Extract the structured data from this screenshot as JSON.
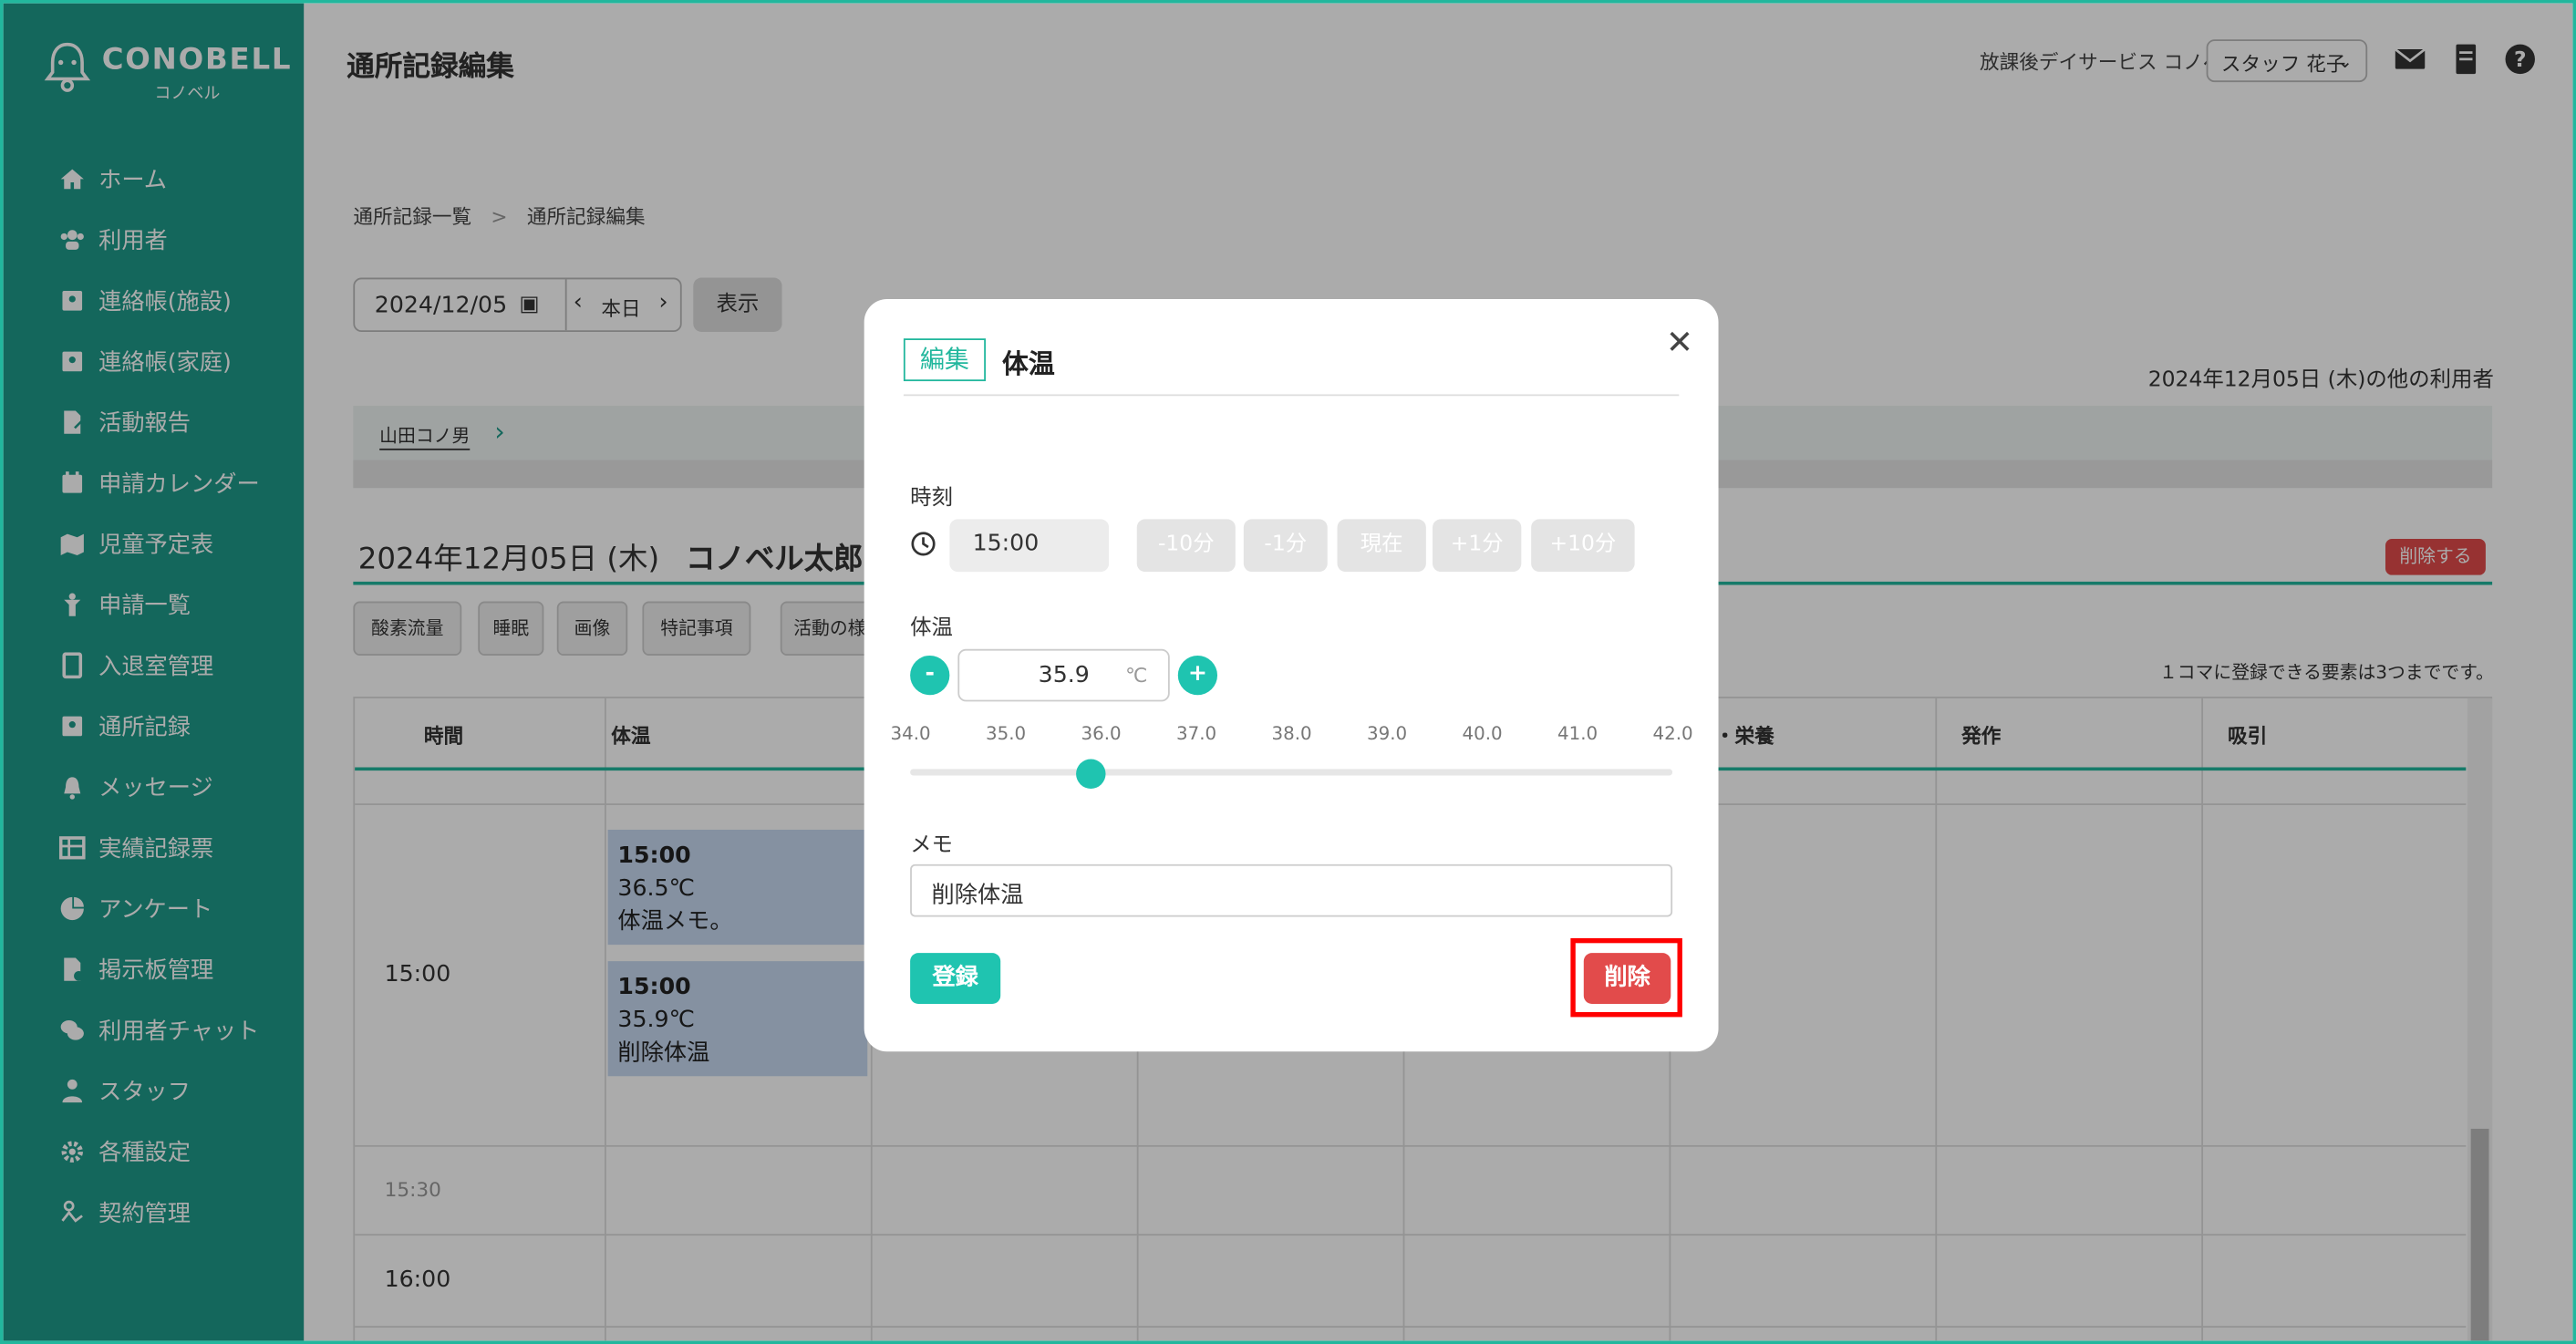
{
  "app": {
    "brand": "CONOBELL",
    "brand_sub": "コノベル"
  },
  "sidebar": {
    "items": [
      {
        "label": "ホーム"
      },
      {
        "label": "利用者"
      },
      {
        "label": "連絡帳(施設)"
      },
      {
        "label": "連絡帳(家庭)"
      },
      {
        "label": "活動報告"
      },
      {
        "label": "申請カレンダー"
      },
      {
        "label": "児童予定表"
      },
      {
        "label": "申請一覧"
      },
      {
        "label": "入退室管理"
      },
      {
        "label": "通所記録"
      },
      {
        "label": "メッセージ"
      },
      {
        "label": "実績記録票"
      },
      {
        "label": "アンケート"
      },
      {
        "label": "掲示板管理"
      },
      {
        "label": "利用者チャット"
      },
      {
        "label": "スタッフ"
      },
      {
        "label": "各種設定"
      },
      {
        "label": "契約管理"
      }
    ]
  },
  "header": {
    "title": "通所記録編集",
    "facility": "放課後デイサービス コノベル",
    "staff": "スタッフ 花子"
  },
  "breadcrumb": {
    "item1": "通所記録一覧",
    "sep": ">",
    "item2": "通所記録編集"
  },
  "date_nav": {
    "date": "2024/12/05",
    "today": "本日",
    "show": "表示"
  },
  "others_label": "2024年12月05日 (木)の他の利用者",
  "user_strip": {
    "name": "山田コノ男"
  },
  "record": {
    "date": "2024年12月05日 (木)",
    "name": "コノベル太郎",
    "delete_label": "削除する"
  },
  "tags": [
    "酸素流量",
    "睡眠",
    "画像",
    "特記事項",
    "活動の様"
  ],
  "limit_note": "１コマに登録できる要素は3つまでです。",
  "grid": {
    "headers": {
      "time": "時間",
      "temp": "体温",
      "nutrition": "・栄養",
      "seizure": "発作",
      "suction": "吸引"
    },
    "times": {
      "t1500": "15:00",
      "t1530": "15:30",
      "t1600": "16:00"
    },
    "entries": [
      {
        "time": "15:00",
        "value": "36.5℃",
        "memo": "体温メモ。"
      },
      {
        "time": "15:00",
        "value": "35.9℃",
        "memo": "削除体温"
      }
    ]
  },
  "modal": {
    "mode": "編集",
    "title": "体温",
    "time_label": "時刻",
    "time_value": "15:00",
    "adjust": [
      "-10分",
      "-1分",
      "現在",
      "+1分",
      "+10分"
    ],
    "temp_label": "体温",
    "temp_value": "35.9",
    "temp_unit": "℃",
    "slider": {
      "ticks": [
        "34.0",
        "35.0",
        "36.0",
        "37.0",
        "38.0",
        "39.0",
        "40.0",
        "41.0",
        "42.0"
      ],
      "min": 34.0,
      "max": 42.0,
      "value": 35.9
    },
    "memo_label": "メモ",
    "memo_value": "削除体温",
    "save": "登録",
    "delete": "削除"
  },
  "colors": {
    "accent": "#1fc4b0",
    "sidebar": "#1f9a8a",
    "danger": "#e24b4b",
    "highlight": "#ff0000"
  }
}
